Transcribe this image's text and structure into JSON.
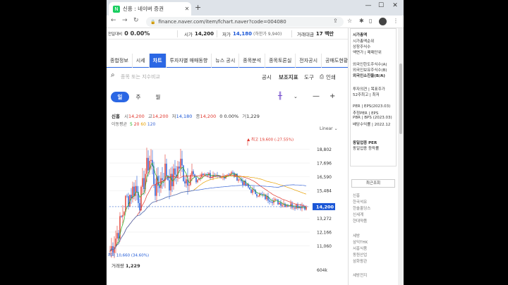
{
  "browser": {
    "tab_title": "신흥 : 네이버 증권",
    "favicon_letter": "N",
    "url": "finance.naver.com/item/fchart.naver?code=004080"
  },
  "summary": {
    "prev_label": "전일대비",
    "change_text": "0  0.00%",
    "open_label": "시가",
    "open_value": "14,200",
    "low_label": "저가",
    "low_value": "14,180",
    "low_sub": "(하한가 9,940)",
    "amount_label": "거래대금",
    "amount_value": "17 백만"
  },
  "nav_tabs": [
    "종합정보",
    "시세",
    "차트",
    "투자자별 매매동향",
    "뉴스 공시",
    "종목분석",
    "종목토론실",
    "전자공시",
    "공매도현황"
  ],
  "search": {
    "placeholder": "종목 또는 지수비교",
    "tools": [
      "공시",
      "보조지표",
      "도구",
      "인쇄"
    ]
  },
  "period_tabs": [
    "일",
    "주",
    "월"
  ],
  "ohlc": {
    "name": "신흥",
    "items": [
      {
        "k": "시",
        "v": "14,200"
      },
      {
        "k": "고",
        "v": "14,200"
      },
      {
        "k": "저",
        "v": "14,180"
      },
      {
        "k": "종",
        "v": "14,200"
      },
      {
        "k": "",
        "v": "0 0.00%"
      },
      {
        "k": "거",
        "v": "1,229"
      }
    ],
    "ma_label": "이동평균",
    "ma_periods": [
      "5",
      "20",
      "60",
      "120"
    ]
  },
  "scale_mode": "Linear",
  "price_axis": [
    "18,802",
    "17,696",
    "16,590",
    "15,484",
    "14,200",
    "13,272",
    "12,166",
    "11,060"
  ],
  "high_marker": "최고 19,600 (-27.55%)",
  "low_marker": "최저 10,660 (34.60%)",
  "current_price_tag": "14,200",
  "volume": {
    "label": "거래량",
    "value": "1,229",
    "axis_top": "604k"
  },
  "right_col": {
    "market_cap_label": "시가총액",
    "lines1": [
      "시가총액순위",
      "상장주식수",
      "액면가 | 매매단위"
    ],
    "foreign_label": "외국인한도주식수(A)",
    "foreign_lines": [
      "외국인보유주식수(B)",
      "외국인소진율(B/A)"
    ],
    "invest_lines": [
      "투자의견 | 목표주가",
      "52주최고 | 최저"
    ],
    "per_lines": [
      "PER | EPS(2023.03)",
      "추정PER | EPS",
      "PBR | BPS (2023.03)",
      "배당수익률 | 2022.12"
    ],
    "industry_lines": [
      "동일업종 PER",
      "동일업종 등락률"
    ],
    "recent_label": "최근조회",
    "recent_items": [
      "신흥",
      "한국석유",
      "한솔홀딩스",
      "신세계",
      "현대약품"
    ],
    "recent_items2": [
      "세방",
      "삼익THK",
      "서흥식품",
      "동원산업",
      "삼화왕관"
    ],
    "extra": "세방전지"
  },
  "chart_data": {
    "type": "candlestick",
    "title": "",
    "xlabel": "",
    "ylabel": "",
    "ylim": [
      10300,
      19900
    ],
    "y_ticks": [
      18802,
      17696,
      16590,
      15484,
      14200,
      13272,
      12166,
      11060
    ],
    "approx_close_path": [
      10660,
      11600,
      12800,
      14500,
      15200,
      15800,
      14600,
      16900,
      18200,
      15600,
      16300,
      17200,
      16000,
      16900,
      17600,
      16400,
      16900,
      16200,
      16600,
      16900,
      16700,
      16500,
      16400,
      16800,
      16900,
      16600,
      16300,
      15900,
      15500,
      15300,
      15100,
      14900,
      14800,
      14600,
      14500,
      14400,
      14300,
      14300,
      14250,
      14200
    ],
    "high": 19600,
    "low": 10660,
    "last": 14200,
    "ma_colors": {
      "5": "#20b020",
      "20": "#e0352b",
      "60": "#e8a000",
      "120": "#3a66d6"
    }
  }
}
